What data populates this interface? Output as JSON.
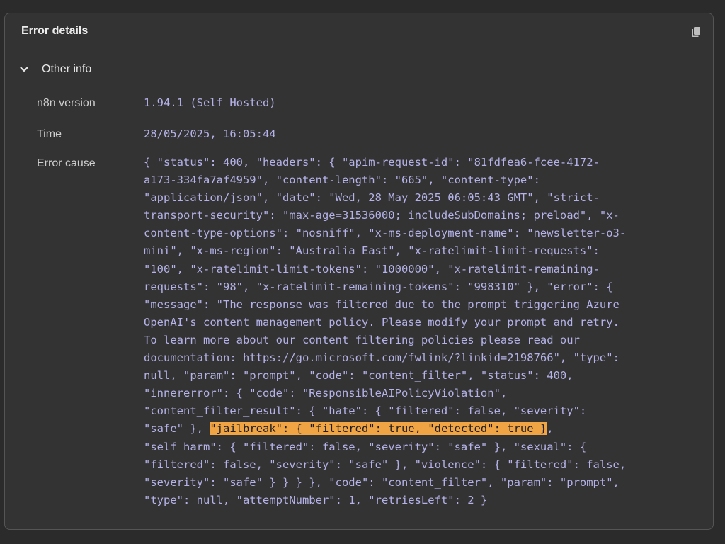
{
  "panel": {
    "title": "Error details",
    "copy_icon": "copy-icon"
  },
  "section": {
    "label": "Other info",
    "chevron_icon": "chevron-down-icon",
    "expanded": true
  },
  "rows": [
    {
      "key": "n8n version",
      "value": "1.94.1 (Self Hosted)"
    },
    {
      "key": "Time",
      "value": "28/05/2025, 16:05:44"
    },
    {
      "key": "Error cause",
      "lines": [
        "{ \"status\": 400, \"headers\": { \"apim-request-id\": \"81fdfea6-fcee-4172-",
        "a173-334fa7af4959\", \"content-length\": \"665\", \"content-type\":",
        "\"application/json\", \"date\": \"Wed, 28 May 2025 06:05:43 GMT\", \"strict-",
        "transport-security\": \"max-age=31536000; includeSubDomains; preload\", \"x-",
        "content-type-options\": \"nosniff\", \"x-ms-deployment-name\": \"newsletter-o3-",
        "mini\", \"x-ms-region\": \"Australia East\", \"x-ratelimit-limit-requests\":",
        "\"100\", \"x-ratelimit-limit-tokens\": \"1000000\", \"x-ratelimit-remaining-",
        "requests\": \"98\", \"x-ratelimit-remaining-tokens\": \"998310\" }, \"error\": {",
        "\"message\": \"The response was filtered due to the prompt triggering Azure",
        "OpenAI's content management policy. Please modify your prompt and retry.",
        "To learn more about our content filtering policies please read our",
        "documentation: https://go.microsoft.com/fwlink/?linkid=2198766\", \"type\":",
        "null, \"param\": \"prompt\", \"code\": \"content_filter\", \"status\": 400,",
        "\"innererror\": { \"code\": \"ResponsibleAIPolicyViolation\",",
        "\"content_filter_result\": { \"hate\": { \"filtered\": false, \"severity\":"
      ],
      "highlight_line": {
        "before": "\"safe\" }, ",
        "highlighted": "\"jailbreak\": { \"filtered\": true, \"detected\": true }",
        "after": ","
      },
      "lines_after": [
        "\"self_harm\": { \"filtered\": false, \"severity\": \"safe\" }, \"sexual\": {",
        "\"filtered\": false, \"severity\": \"safe\" }, \"violence\": { \"filtered\": false,",
        "\"severity\": \"safe\" } } } }, \"code\": \"content_filter\", \"param\": \"prompt\",",
        "\"type\": null, \"attemptNumber\": 1, \"retriesLeft\": 2 }"
      ]
    }
  ],
  "colors": {
    "background": "#2b2b2b",
    "panel": "#333333",
    "border": "#555555",
    "value_text": "#b4b2e8",
    "highlight": "#f0a444"
  }
}
